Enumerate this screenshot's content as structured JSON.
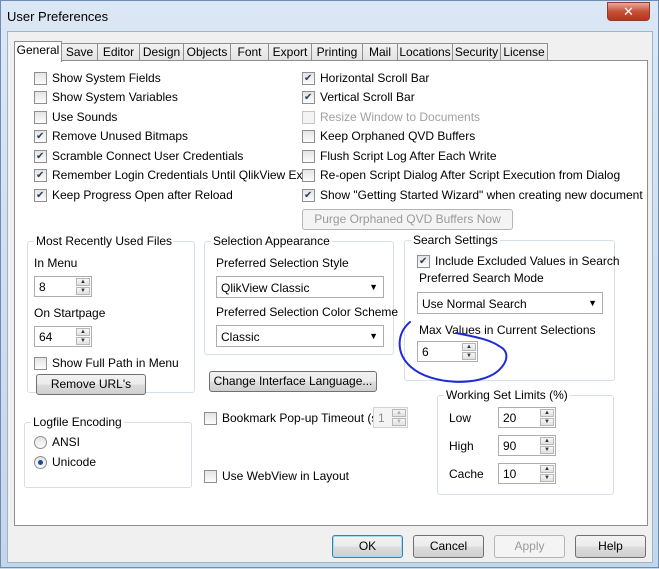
{
  "window": {
    "title": "User Preferences",
    "close_label": "✕"
  },
  "tabs": [
    {
      "label": "General"
    },
    {
      "label": "Save"
    },
    {
      "label": "Editor"
    },
    {
      "label": "Design"
    },
    {
      "label": "Objects"
    },
    {
      "label": "Font"
    },
    {
      "label": "Export"
    },
    {
      "label": "Printing"
    },
    {
      "label": "Mail"
    },
    {
      "label": "Locations"
    },
    {
      "label": "Security"
    },
    {
      "label": "License"
    }
  ],
  "left_checks": [
    {
      "label": "Show System Fields",
      "checked": false
    },
    {
      "label": "Show System Variables",
      "checked": false
    },
    {
      "label": "Use Sounds",
      "checked": false
    },
    {
      "label": "Remove Unused Bitmaps",
      "checked": true
    },
    {
      "label": "Scramble Connect User Credentials",
      "checked": true
    },
    {
      "label": "Remember Login Credentials Until QlikView Exits",
      "checked": true
    },
    {
      "label": "Keep Progress Open after Reload",
      "checked": true
    }
  ],
  "right_checks": [
    {
      "label": "Horizontal Scroll Bar",
      "checked": true
    },
    {
      "label": "Vertical Scroll Bar",
      "checked": true
    },
    {
      "label": "Resize Window to Documents",
      "checked": false,
      "disabled": true
    },
    {
      "label": "Keep Orphaned QVD Buffers",
      "checked": false
    },
    {
      "label": "Flush Script Log After Each Write",
      "checked": false
    },
    {
      "label": "Re-open Script Dialog After Script Execution from Dialog",
      "checked": false
    },
    {
      "label": "Show \"Getting Started Wizard\" when creating new document",
      "checked": true
    }
  ],
  "purge_button": "Purge Orphaned QVD Buffers Now",
  "mru": {
    "title": "Most Recently Used Files",
    "in_menu_label": "In Menu",
    "in_menu_value": "8",
    "on_startpage_label": "On Startpage",
    "on_startpage_value": "64",
    "full_path_label": "Show Full Path in Menu",
    "full_path_checked": false,
    "remove_button": "Remove URL's"
  },
  "selection": {
    "title": "Selection Appearance",
    "style_label": "Preferred Selection Style",
    "style_value": "QlikView Classic",
    "color_label": "Preferred Selection Color Scheme",
    "color_value": "Classic"
  },
  "search": {
    "title": "Search Settings",
    "include_excluded_label": "Include Excluded Values in Search",
    "include_excluded_checked": true,
    "mode_label": "Preferred Search Mode",
    "mode_value": "Use Normal Search",
    "max_values_label": "Max Values in Current Selections",
    "max_values_value": "6"
  },
  "change_language_button": "Change Interface Language...",
  "logfile": {
    "title": "Logfile Encoding",
    "options": [
      {
        "label": "ANSI",
        "selected": false
      },
      {
        "label": "Unicode",
        "selected": true
      }
    ]
  },
  "bookmark": {
    "label": "Bookmark Pop-up Timeout (s)",
    "checked": false,
    "value": "1"
  },
  "webview": {
    "label": "Use WebView in Layout",
    "checked": false
  },
  "working_set": {
    "title": "Working Set Limits (%)",
    "low_label": "Low",
    "low_value": "20",
    "high_label": "High",
    "high_value": "90",
    "cache_label": "Cache",
    "cache_value": "10"
  },
  "footer": {
    "ok": "OK",
    "cancel": "Cancel",
    "apply": "Apply",
    "help": "Help"
  },
  "colors": {
    "annotation": "#1f2bd6"
  }
}
